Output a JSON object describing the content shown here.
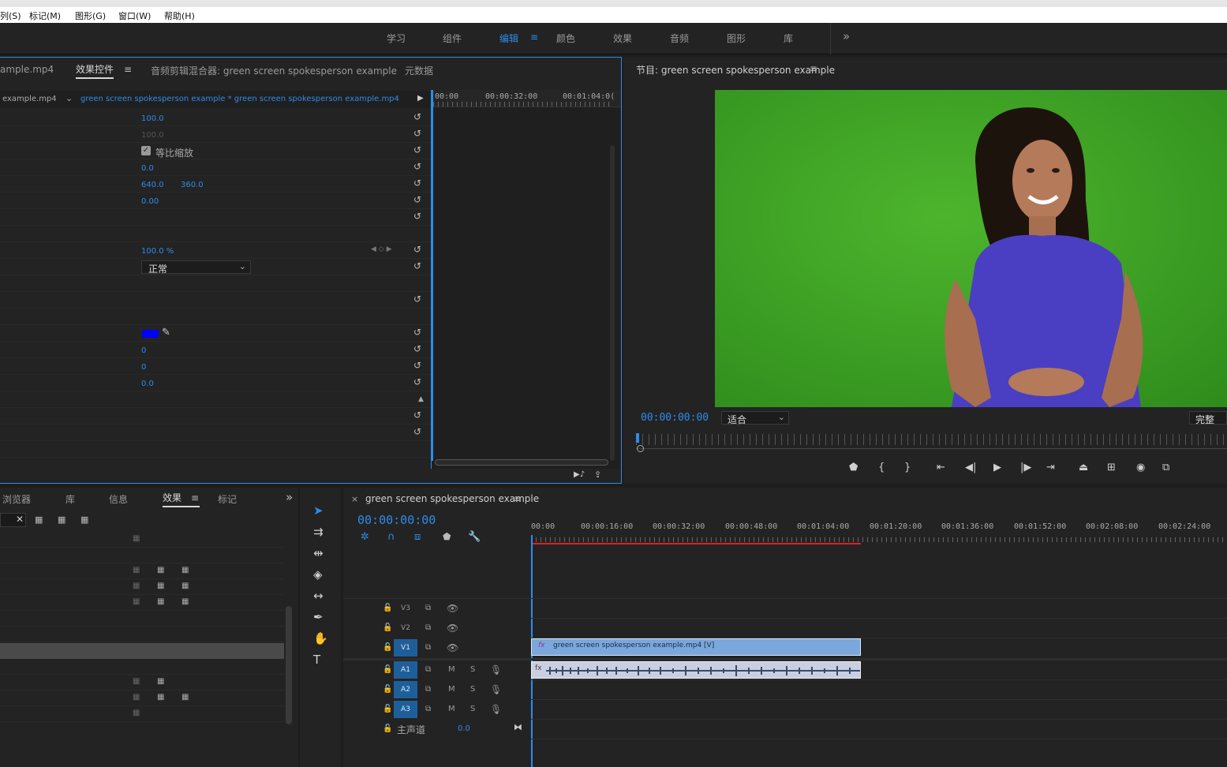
{
  "menu": {
    "items": [
      "列(S)",
      "标记(M)",
      "图形(G)",
      "窗口(W)",
      "帮助(H)"
    ]
  },
  "workspaces": {
    "items": [
      "学习",
      "组件",
      "编辑",
      "颜色",
      "效果",
      "音频",
      "图形",
      "库"
    ],
    "active": "编辑",
    "menu_icon": "≡",
    "overflow": "»"
  },
  "effect_controls": {
    "tabs": {
      "source": "ample.mp4",
      "effect": "效果控件",
      "audio_mixer": "音频剪辑混合器: green screen spokesperson example",
      "metadata": "元数据"
    },
    "clip_source": "example.mp4",
    "clip_label": "green screen spokesperson example * green screen spokesperson example.mp4",
    "timecodes": [
      "00:00",
      "00:00:32:00",
      "00:01:04:0("
    ],
    "rows": {
      "scale": "100.0",
      "scale_width": "100.0",
      "uniform_scale": "等比缩放",
      "rotation": "0.0",
      "anchor_x": "640.0",
      "anchor_y": "360.0",
      "anti_flicker": "0.00",
      "opacity": "100.0 %",
      "blend_mode": "正常",
      "key_color": "#0000ff",
      "v1": "0",
      "v2": "0",
      "v3": "0.0"
    }
  },
  "program": {
    "title": "节目: green screen spokesperson example",
    "timecode": "00:00:00:00",
    "fit": "适合",
    "quality": "完整"
  },
  "project": {
    "tabs": [
      "浏览器",
      "库",
      "信息",
      "效果",
      "标记"
    ],
    "active": "效果"
  },
  "timeline": {
    "sequence": "green screen spokesperson example",
    "timecode": "00:00:00:00",
    "ruler": [
      "00:00",
      "00:00:16:00",
      "00:00:32:00",
      "00:00:48:00",
      "00:01:04:00",
      "00:01:20:00",
      "00:01:36:00",
      "00:01:52:00",
      "00:02:08:00",
      "00:02:24:00"
    ],
    "tracks": {
      "video": [
        "V3",
        "V2",
        "V1"
      ],
      "audio": [
        "A1",
        "A2",
        "A3"
      ],
      "master": "主声道",
      "master_value": "0.0",
      "m": "M",
      "s": "S"
    },
    "clip_label": "green screen spokesperson example.mp4 [V]",
    "fx_badge": "fx"
  },
  "colors": {
    "accent": "#2d8ceb",
    "video_clip": "#7aa7dc",
    "audio_clip": "#c9cfe0",
    "green_screen": "#3e9e26",
    "shirt": "#4a3fc2"
  }
}
